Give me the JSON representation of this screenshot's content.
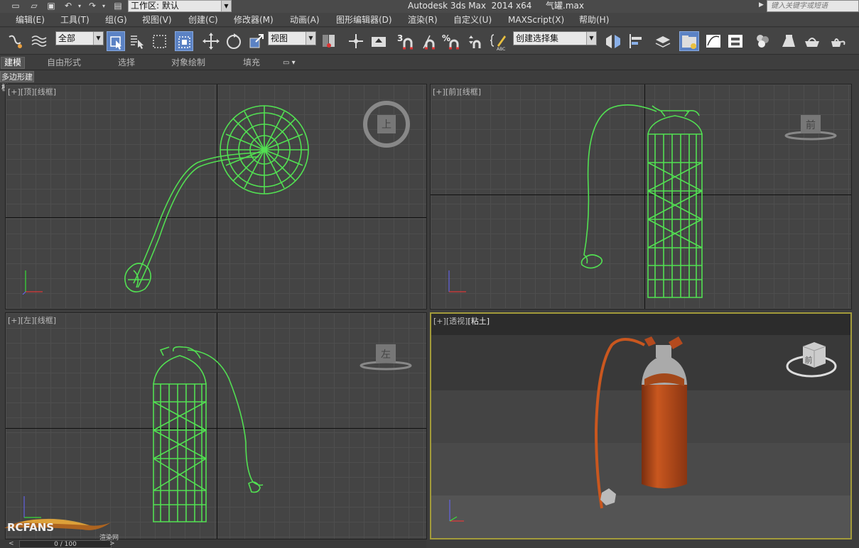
{
  "titlebar": {
    "workspace_label": "工作区: 默认",
    "app_title": "Autodesk 3ds Max  2014 x64",
    "file_name": "气罐.max",
    "search_placeholder": "键入关键字或短语"
  },
  "menu": [
    "编辑(E)",
    "工具(T)",
    "组(G)",
    "视图(V)",
    "创建(C)",
    "修改器(M)",
    "动画(A)",
    "图形编辑器(D)",
    "渲染(R)",
    "自定义(U)",
    "MAXScript(X)",
    "帮助(H)"
  ],
  "toolbar": {
    "selection_filter": "全部",
    "reference_coord": "视图",
    "named_selection": "创建选择集",
    "snap_3": "3",
    "snap_pct": "%"
  },
  "ribbon": {
    "tabs": [
      "建模",
      "自由形式",
      "选择",
      "对象绘制",
      "填充"
    ],
    "subtab": "多边形建模"
  },
  "viewports": {
    "top": {
      "plus": "[+]",
      "view": "[顶]",
      "shade": "[线框]",
      "cube": "上"
    },
    "front": {
      "plus": "[+]",
      "view": "[前]",
      "shade": "[线框]",
      "cube": "前"
    },
    "left": {
      "plus": "[+]",
      "view": "[左]",
      "shade": "[线框]",
      "cube": "左"
    },
    "persp": {
      "plus": "[+]",
      "view": "[透视]",
      "shade": "[粘土]",
      "cube": "前"
    }
  },
  "status": {
    "progress": "0 / 100",
    "logo_text": "RCFANS",
    "logo_sub": "渲染网"
  },
  "colors": {
    "wire": "#52e052",
    "tank": "#b44a1e",
    "active_border": "#a39b3a",
    "highlight": "#5b82c4"
  }
}
